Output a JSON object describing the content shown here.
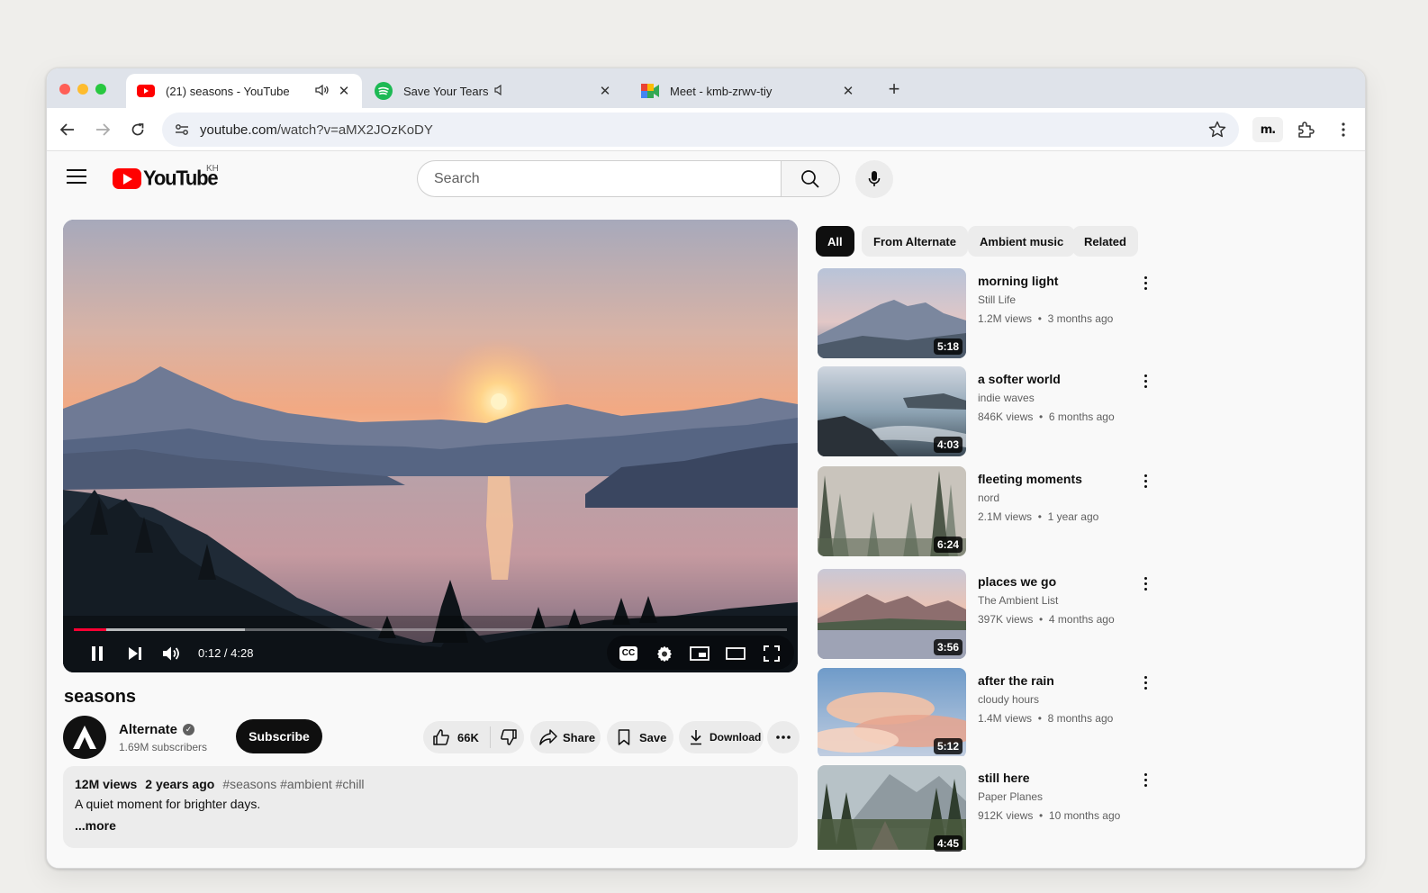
{
  "browser": {
    "tabs": [
      {
        "title": "(21) seasons - YouTube",
        "favicon": "youtube-icon",
        "audio": "speaker-icon"
      },
      {
        "title": "Save Your Tears • The Weeknd",
        "favicon": "spotify-icon",
        "audio": "muted-speaker-icon"
      },
      {
        "title": "Meet - kmb-zrwv-tiy",
        "favicon": "meet-icon"
      }
    ],
    "url_host": "youtube.com",
    "url_path": "/watch?v=aMX2JOzKoDY",
    "extension_label": "m."
  },
  "youtube": {
    "logo_text": "YouTube",
    "country_code": "KH",
    "search_placeholder": "Search"
  },
  "player": {
    "time_current": "0:12",
    "time_separator": " / ",
    "time_total": "4:28",
    "progress_fraction": 0.045,
    "buffered_fraction": 0.24,
    "cc_label": "CC"
  },
  "video": {
    "title": "seasons",
    "channel": "Alternate",
    "subscribers": "1.69M subscribers",
    "subscribe_label": "Subscribe",
    "likes": "66K",
    "share_label": "Share",
    "save_label": "Save",
    "download_label": "Download",
    "views": "12M views",
    "age": "2 years ago",
    "hashtags": "#seasons #ambient #chill",
    "description": "A quiet moment for brighter days.",
    "more_label": "...more"
  },
  "chips": [
    "All",
    "From Alternate",
    "Ambient music",
    "Related"
  ],
  "recommendations": [
    {
      "title": "morning light",
      "channel": "Still Life",
      "views": "1.2M views",
      "age": "3 months ago",
      "duration": "5:18"
    },
    {
      "title": "a softer world",
      "channel": "indie waves",
      "views": "846K views",
      "age": "6 months ago",
      "duration": "4:03"
    },
    {
      "title": "fleeting moments",
      "channel": "nord",
      "views": "2.1M views",
      "age": "1 year ago",
      "duration": "6:24"
    },
    {
      "title": "places we go",
      "channel": "The Ambient List",
      "views": "397K views",
      "age": "4 months ago",
      "duration": "3:56"
    },
    {
      "title": "after the rain",
      "channel": "cloudy hours",
      "views": "1.4M views",
      "age": "8 months ago",
      "duration": "5:12"
    },
    {
      "title": "still here",
      "channel": "Paper Planes",
      "views": "912K views",
      "age": "10 months ago",
      "duration": "4:45"
    }
  ],
  "meta_separator": "•",
  "colors": {
    "youtube_red": "#ff0000",
    "progress_red": "#ff0033",
    "spotify_green": "#1db954"
  }
}
